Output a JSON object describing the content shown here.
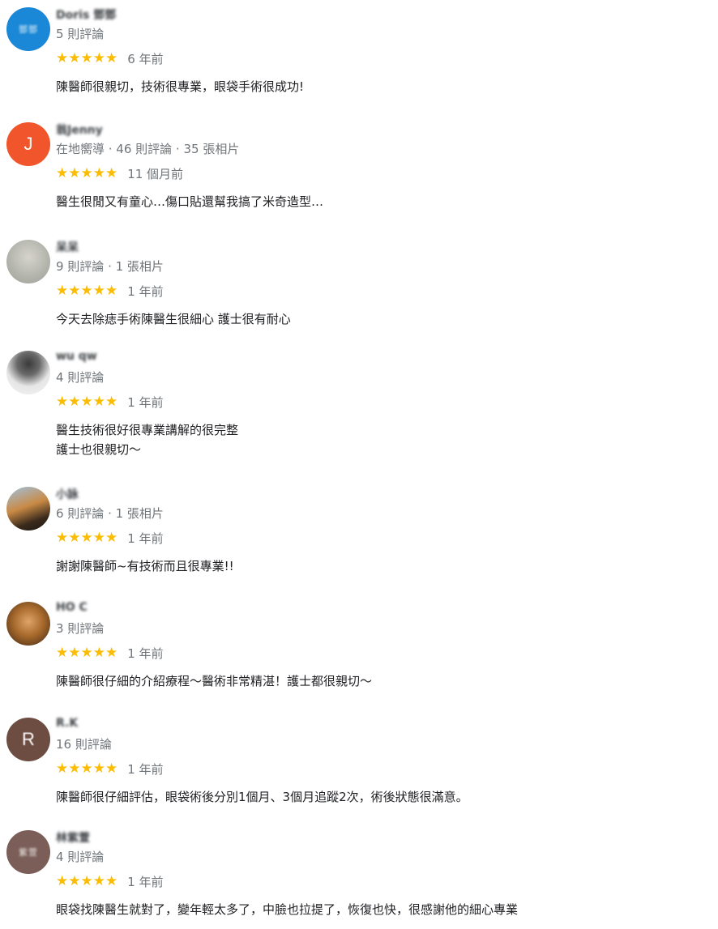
{
  "reviews": [
    {
      "name": "Doris 鄧鄧",
      "avatar_text": "鄧鄧",
      "avatar_color": "#1a88d6",
      "meta": "5 則評論",
      "stars": "★★★★★",
      "time": "6 年前",
      "text": "陳醫師很親切，技術很專業，眼袋手術很成功!"
    },
    {
      "name": "翁Jenny",
      "avatar_text": "J",
      "avatar_color": "#f0552b",
      "meta": "在地嚮導 · 46 則評論 · 35 張相片",
      "stars": "★★★★★",
      "time": "11 個月前",
      "text": "醫生很閒又有童心…傷口貼還幫我搞了米奇造型…"
    },
    {
      "name": "呆呆",
      "avatar_text": "",
      "avatar_color": "#b9bcb4",
      "meta": "9 則評論 · 1 張相片",
      "stars": "★★★★★",
      "time": "1 年前",
      "text": "今天去除痣手術陳醫生很細心 護士很有耐心"
    },
    {
      "name": "wu qw",
      "avatar_text": "",
      "avatar_color": "#e8e8e8",
      "meta": "4 則評論",
      "stars": "★★★★★",
      "time": "1 年前",
      "text": "醫生技術很好很專業講解的很完整\n護士也很親切～"
    },
    {
      "name": "小詠",
      "avatar_text": "",
      "avatar_color": "#6b5a3e",
      "meta": "6 則評論 · 1 張相片",
      "stars": "★★★★★",
      "time": "1 年前",
      "text": "謝謝陳醫師~有技術而且很專業!!"
    },
    {
      "name": "HO C",
      "avatar_text": "",
      "avatar_color": "#a86a2c",
      "meta": "3 則評論",
      "stars": "★★★★★",
      "time": "1 年前",
      "text": "陳醫師很仔細的介紹療程～醫術非常精湛！護士都很親切～"
    },
    {
      "name": "R.K",
      "avatar_text": "R",
      "avatar_color": "#6d4c41",
      "meta": "16 則評論",
      "stars": "★★★★★",
      "time": "1 年前",
      "text": "陳醫師很仔細評估，眼袋術後分別1個月、3個月追蹤2次，術後狀態很滿意。"
    },
    {
      "name": "林紫萱",
      "avatar_text": "紫萱",
      "avatar_color": "#7b5e57",
      "meta": "4 則評論",
      "stars": "★★★★★",
      "time": "1 年前",
      "text": "眼袋找陳醫生就對了，變年輕太多了，中臉也拉提了，恢復也快，很感謝他的細心專業"
    }
  ]
}
